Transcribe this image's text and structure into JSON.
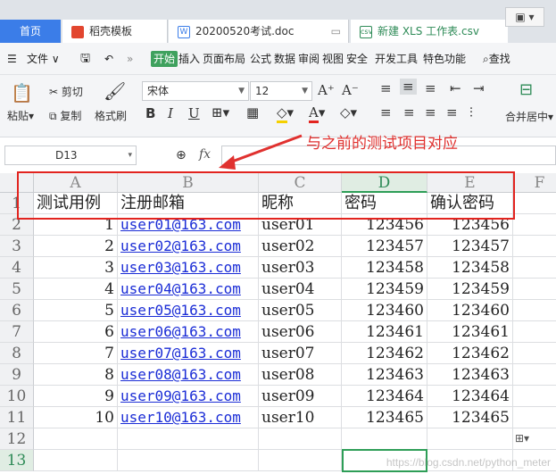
{
  "tabs": [
    {
      "label": "首页"
    },
    {
      "label": "稻壳模板"
    },
    {
      "label": "20200520考试.doc"
    },
    {
      "label": "新建 XLS 工作表.csv"
    }
  ],
  "menu": [
    "文件",
    "开始",
    "插入",
    "页面布局",
    "公式",
    "数据",
    "审阅",
    "视图",
    "安全",
    "开发工具",
    "特色功能",
    "查找"
  ],
  "ribbon": {
    "paste": "粘贴",
    "cut": "剪切",
    "copy": "复制",
    "format_painter": "格式刷",
    "font_name": "宋体",
    "font_size": "12",
    "merge_center": "合并居中"
  },
  "name_box": "D13",
  "fx_label": "fx",
  "annotation": "与之前的测试项目对应",
  "columns": [
    "A",
    "B",
    "C",
    "D",
    "E",
    "F"
  ],
  "selected_column": "D",
  "selected_row": 13,
  "headers": [
    "测试用例",
    "注册邮箱",
    "昵称",
    "密码",
    "确认密码"
  ],
  "rows": [
    [
      "1",
      "user01@163.com",
      "user01",
      "123456",
      "123456"
    ],
    [
      "2",
      "user02@163.com",
      "user02",
      "123457",
      "123457"
    ],
    [
      "3",
      "user03@163.com",
      "user03",
      "123458",
      "123458"
    ],
    [
      "4",
      "user04@163.com",
      "user04",
      "123459",
      "123459"
    ],
    [
      "5",
      "user05@163.com",
      "user05",
      "123460",
      "123460"
    ],
    [
      "6",
      "user06@163.com",
      "user06",
      "123461",
      "123461"
    ],
    [
      "7",
      "user07@163.com",
      "user07",
      "123462",
      "123462"
    ],
    [
      "8",
      "user08@163.com",
      "user08",
      "123463",
      "123463"
    ],
    [
      "9",
      "user09@163.com",
      "user09",
      "123464",
      "123464"
    ],
    [
      "10",
      "user10@163.com",
      "user10",
      "123465",
      "123465"
    ]
  ],
  "row_numbers": [
    "1",
    "2",
    "3",
    "4",
    "5",
    "6",
    "7",
    "8",
    "9",
    "10",
    "11",
    "12",
    "13"
  ],
  "watermark": "https://blog.csdn.net/python_meter",
  "colors": {
    "accent": "#3fa15e",
    "annotation": "#e0312f",
    "link": "#1b2dd6",
    "home_tab": "#3b7de8"
  }
}
